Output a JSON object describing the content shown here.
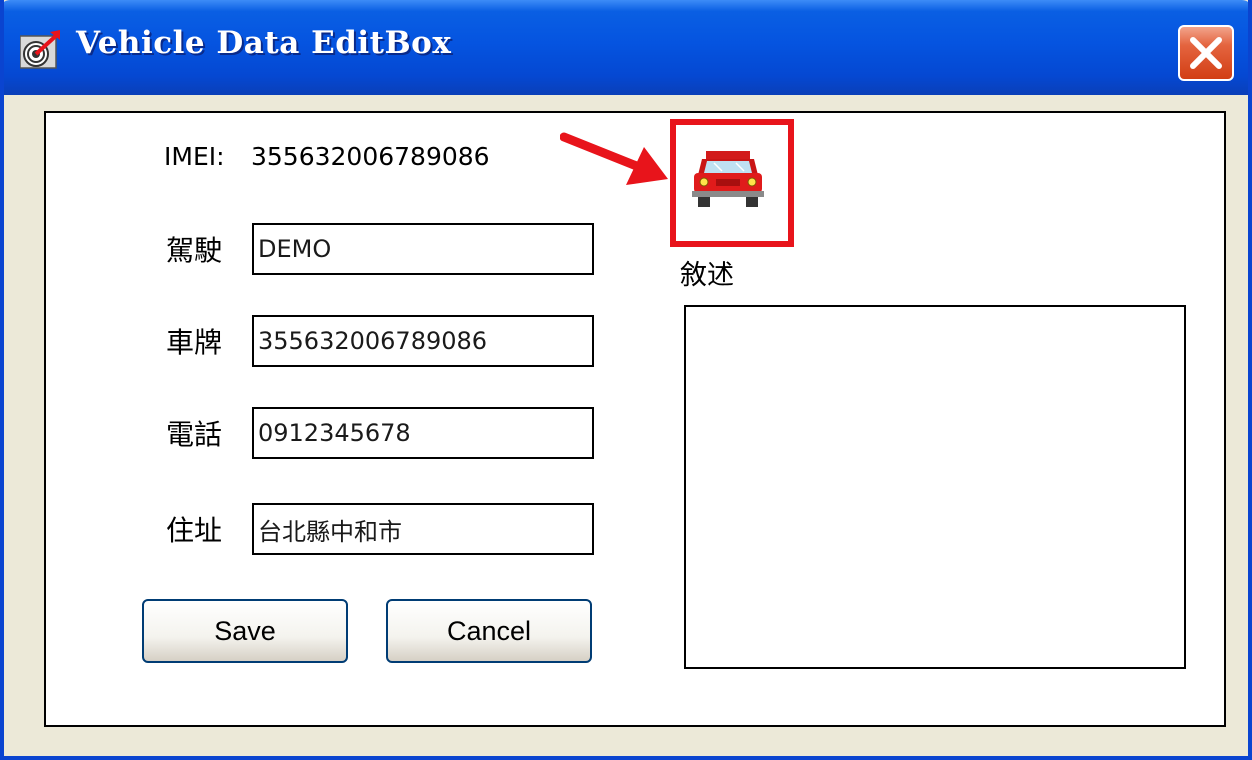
{
  "window": {
    "title": "Vehicle Data EditBox",
    "title_color": "#ffffff",
    "titlebar_color": "#0554e0",
    "close_color": "#d23e14"
  },
  "form": {
    "imei_label": "IMEI:",
    "imei_value": "355632006789086",
    "fields": [
      {
        "label": "駕駛",
        "value": "DEMO"
      },
      {
        "label": "車牌",
        "value": "355632006789086"
      },
      {
        "label": "電話",
        "value": "0912345678"
      },
      {
        "label": "住址",
        "value": "台北縣中和市"
      }
    ],
    "save_label": "Save",
    "cancel_label": "Cancel"
  },
  "vehicle": {
    "icon": "red-car-icon",
    "highlight_color": "#e8141b",
    "description_label": "敘述",
    "description_value": ""
  }
}
